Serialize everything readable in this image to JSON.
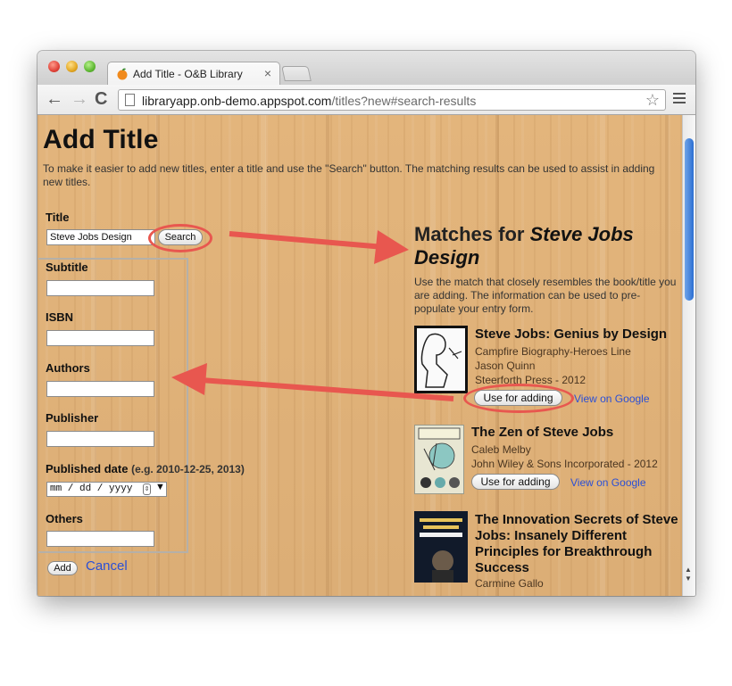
{
  "browser": {
    "tab_title": "Add Title - O&B Library",
    "tab_close": "×",
    "url_host": "libraryapp.onb-demo.appspot.com",
    "url_path": "/titles?new#search-results",
    "back_icon": "←",
    "forward_icon": "→",
    "reload_icon": "C",
    "star_icon": "☆"
  },
  "page": {
    "heading": "Add Title",
    "intro": "To make it easier to add new titles, enter a title and use the \"Search\" button. The matching results can be used to assist in adding new titles."
  },
  "form": {
    "title_label": "Title",
    "title_value": "Steve Jobs Design",
    "search_label": "Search",
    "subtitle_label": "Subtitle",
    "isbn_label": "ISBN",
    "authors_label": "Authors",
    "publisher_label": "Publisher",
    "published_label": "Published date",
    "published_hint": "(e.g. 2010-12-25, 2013)",
    "date_placeholder": "mm / dd / yyyy",
    "date_dropdown": "▼",
    "others_label": "Others",
    "add_label": "Add",
    "cancel_label": "Cancel"
  },
  "matches": {
    "title_prefix": "Matches for ",
    "title_query": "Steve Jobs Design",
    "description": "Use the match that closely resembles the book/title you are adding. The information can be used to pre-populate your entry form.",
    "use_label": "Use for adding",
    "google_label": "View on Google",
    "books": [
      {
        "title": "Steve Jobs: Genius by Design",
        "line1": "Campfire Biography-Heroes Line",
        "line2": "Jason Quinn",
        "line3": "Steerforth Press - 2012"
      },
      {
        "title": "The Zen of Steve Jobs",
        "line1": "Caleb Melby",
        "line2": "John Wiley & Sons Incorporated - 2012"
      },
      {
        "title": "The Innovation Secrets of Steve Jobs: Insanely Different Principles for Breakthrough Success",
        "line1": "Carmine Gallo"
      }
    ]
  },
  "colors": {
    "annotation_red": "#e8574f",
    "link_blue": "#2a4fd6"
  }
}
